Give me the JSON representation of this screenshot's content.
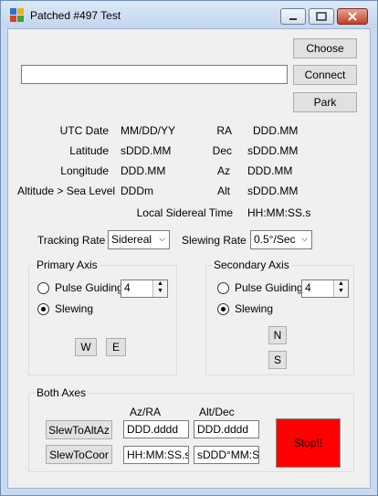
{
  "window": {
    "title": "Patched #497 Test"
  },
  "buttons": {
    "choose": "Choose",
    "connect": "Connect",
    "park": "Park"
  },
  "info": {
    "utc_date_label": "UTC Date",
    "utc_date_value": "MM/DD/YY",
    "latitude_label": "Latitude",
    "latitude_value": "sDDD.MM",
    "longitude_label": "Longitude",
    "longitude_value": "DDD.MM",
    "altitude_label": "Altitude > Sea Level",
    "altitude_value": "DDDm",
    "ra_label": "RA",
    "ra_value": "DDD.MM",
    "dec_label": "Dec",
    "dec_value": "sDDD.MM",
    "az_label": "Az",
    "az_value": "DDD.MM",
    "alt_label": "Alt",
    "alt_value": "sDDD.MM",
    "lst_label": "Local Sidereal Time",
    "lst_value": "HH:MM:SS.s"
  },
  "tracking": {
    "label": "Tracking Rate",
    "value": "Sidereal"
  },
  "slewing": {
    "label": "Slewing Rate",
    "value": "0.5°/Sec"
  },
  "primary_axis": {
    "title": "Primary Axis",
    "pulse_label": "Pulse Guiding",
    "pulse_value": "4",
    "slewing_label": "Slewing",
    "west": "W",
    "east": "E"
  },
  "secondary_axis": {
    "title": "Secondary Axis",
    "pulse_label": "Pulse Guiding",
    "pulse_value": "4",
    "slewing_label": "Slewing",
    "north": "N",
    "south": "S"
  },
  "both_axes": {
    "title": "Both Axes",
    "azra_header": "Az/RA",
    "altdec_header": "Alt/Dec",
    "slew_altaz": "SlewToAltAz",
    "slew_coor": "SlewToCoor",
    "az_field": "DDD.dddd",
    "alt_field": "DDD.dddd",
    "ra_field": "HH:MM:SS.s",
    "dec_field": "sDDD°MM:SS",
    "stop": "Stop!!"
  },
  "colors": {
    "stop": "#ff0000",
    "frame": "#c9daf0"
  }
}
